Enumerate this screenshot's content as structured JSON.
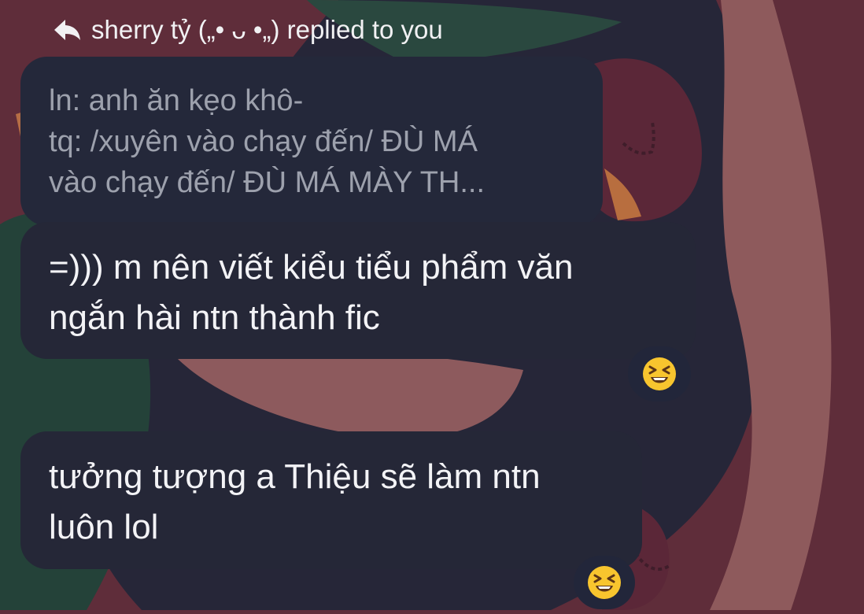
{
  "header": {
    "reply_text": "sherry tỷ („• ᴗ •„) replied to you",
    "icon": "reply-arrow-icon"
  },
  "quoted_message": {
    "lines": [
      "ln: anh ăn kẹo khô-",
      "tq: /xuyên vào chạy đến/ ĐÙ MÁ",
      "vào chạy đến/ ĐÙ MÁ MÀY TH..."
    ]
  },
  "messages": [
    {
      "lines": [
        "=))) m nên viết kiểu tiểu phẩm văn",
        "ngắn hài ntn thành fic"
      ],
      "reaction": "grinning-squinting-face-emoji"
    },
    {
      "lines": [
        "tưởng tượng a Thiệu sẽ làm ntn",
        "luôn lol"
      ],
      "reaction": "grinning-squinting-face-emoji"
    }
  ],
  "colors": {
    "background": "#5f2d3a",
    "bubble": "#252737",
    "quoted_text": "#9da1ad",
    "message_text": "#f3f3f6",
    "emoji_yellow": "#f8c52e"
  }
}
